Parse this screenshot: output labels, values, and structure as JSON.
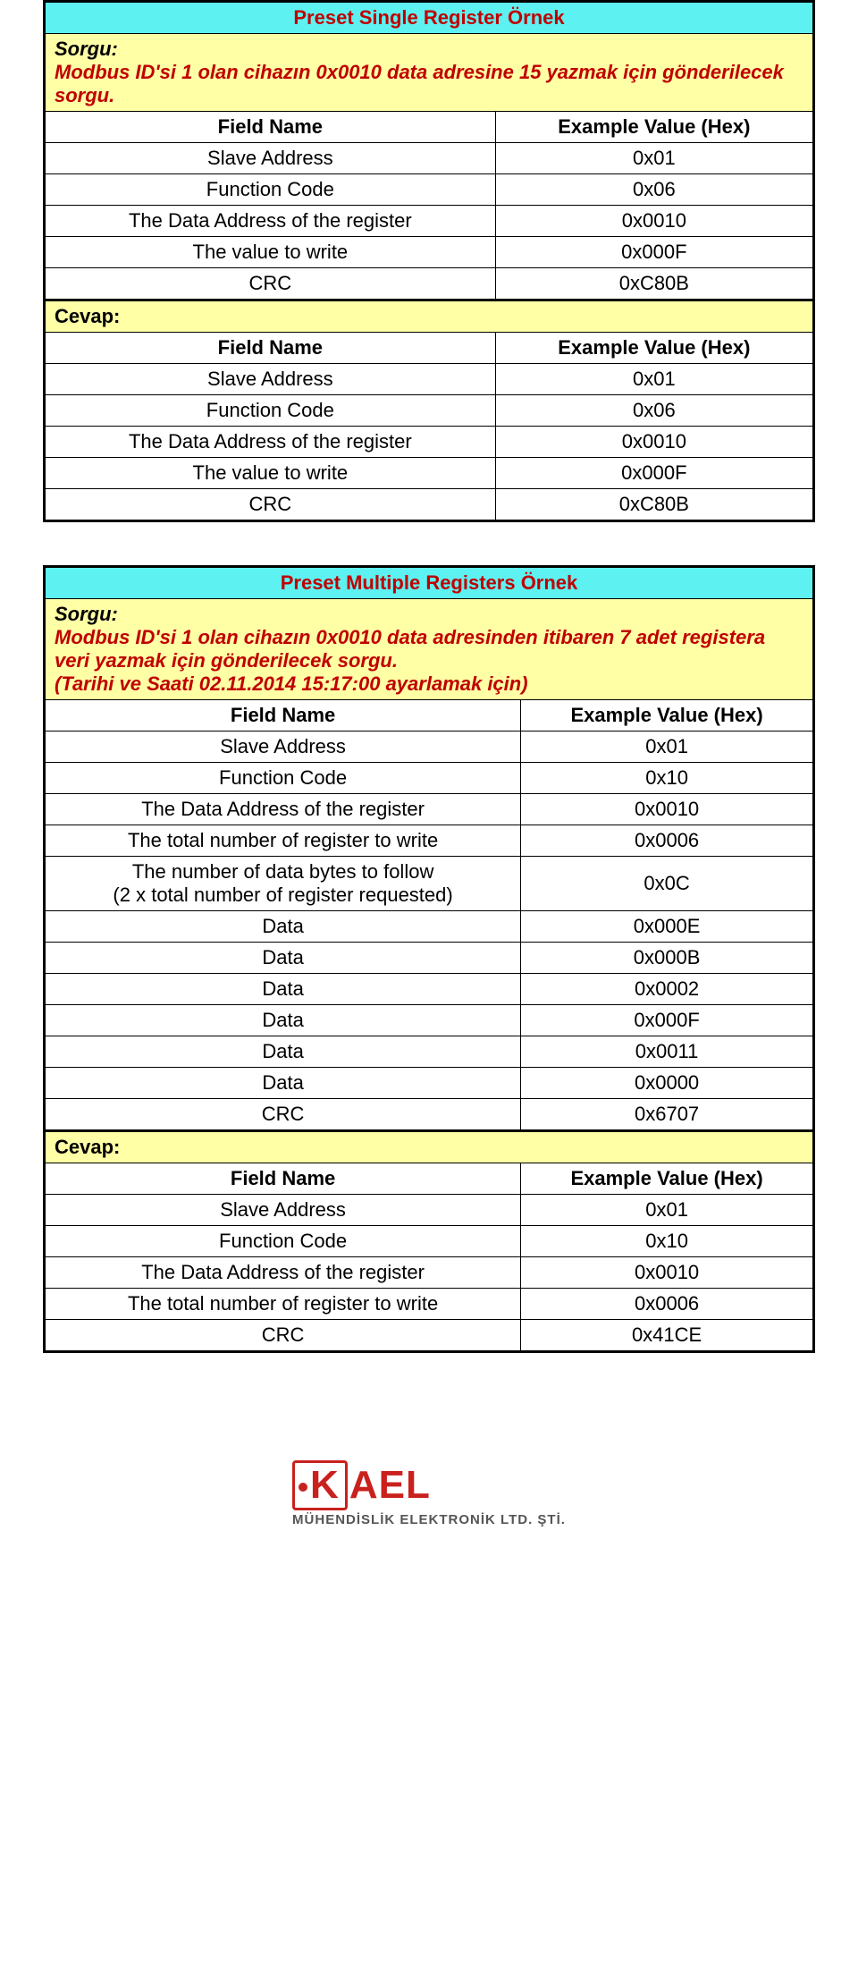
{
  "block1": {
    "title": "Preset Single Register Örnek",
    "sorgu_label": "Sorgu:",
    "sorgu_text": "Modbus ID'si 1 olan cihazın 0x0010 data adresine 15 yazmak için gönderilecek sorgu.",
    "col_field": "Field Name",
    "col_value": "Example Value (Hex)",
    "req": [
      {
        "f": "Slave Address",
        "v": "0x01"
      },
      {
        "f": "Function Code",
        "v": "0x06"
      },
      {
        "f": "The Data Address of the register",
        "v": "0x0010"
      },
      {
        "f": "The value to write",
        "v": "0x000F"
      },
      {
        "f": "CRC",
        "v": "0xC80B"
      }
    ],
    "cevap": "Cevap:",
    "res": [
      {
        "f": "Slave Address",
        "v": "0x01"
      },
      {
        "f": "Function Code",
        "v": "0x06"
      },
      {
        "f": "The Data Address of the register",
        "v": "0x0010"
      },
      {
        "f": "The value to write",
        "v": "0x000F"
      },
      {
        "f": "CRC",
        "v": "0xC80B"
      }
    ]
  },
  "block2": {
    "title": "Preset Multiple Registers Örnek",
    "sorgu_label": "Sorgu:",
    "sorgu_text1": "Modbus ID'si 1 olan cihazın 0x0010 data adresinden itibaren 7 adet registera veri yazmak için gönderilecek sorgu.",
    "sorgu_text2": "(Tarihi ve Saati 02.11.2014 15:17:00 ayarlamak için)",
    "col_field": "Field Name",
    "col_value": "Example Value (Hex)",
    "req": [
      {
        "f": "Slave Address",
        "v": "0x01"
      },
      {
        "f": "Function Code",
        "v": "0x10"
      },
      {
        "f": "The Data Address of the register",
        "v": "0x0010"
      },
      {
        "f": "The total number of register to write",
        "v": "0x0006"
      },
      {
        "f": "The number of data bytes to follow\n(2 x total number of register requested)",
        "v": "0x0C"
      },
      {
        "f": "Data",
        "v": "0x000E"
      },
      {
        "f": "Data",
        "v": "0x000B"
      },
      {
        "f": "Data",
        "v": "0x0002"
      },
      {
        "f": "Data",
        "v": "0x000F"
      },
      {
        "f": "Data",
        "v": "0x0011"
      },
      {
        "f": "Data",
        "v": "0x0000"
      },
      {
        "f": "CRC",
        "v": "0x6707"
      }
    ],
    "cevap": "Cevap:",
    "res": [
      {
        "f": "Slave Address",
        "v": "0x01"
      },
      {
        "f": "Function Code",
        "v": "0x10"
      },
      {
        "f": "The Data Address of the register",
        "v": "0x0010"
      },
      {
        "f": "The total number of register to write",
        "v": "0x0006"
      },
      {
        "f": "CRC",
        "v": "0x41CE"
      }
    ]
  },
  "footer": {
    "brand": "KAEL",
    "sub": "MÜHENDİSLİK ELEKTRONİK LTD. ŞTİ."
  }
}
